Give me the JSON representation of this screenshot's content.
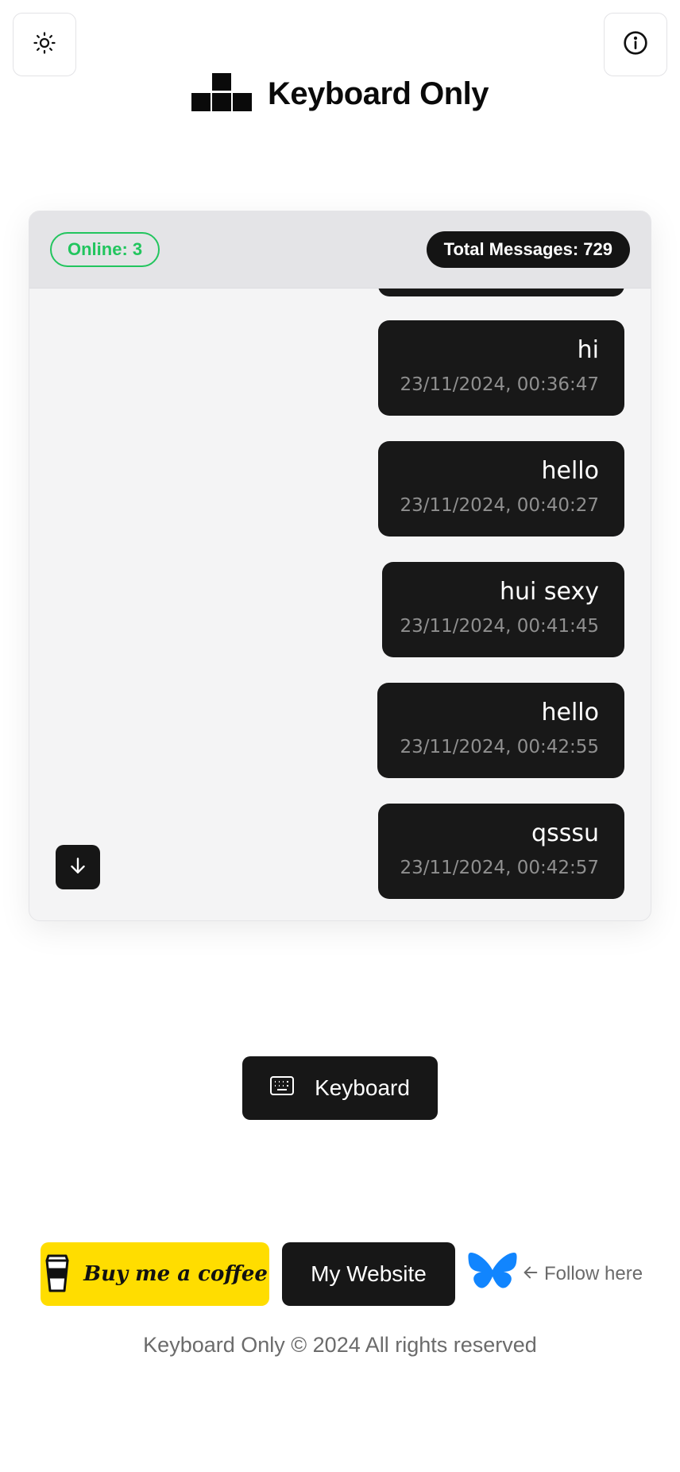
{
  "header": {
    "theme_icon": "sun-icon",
    "info_icon": "info-icon",
    "logo_icon": "keyboard-blocks-icon",
    "title": "Keyboard Only"
  },
  "chat": {
    "online_label": "Online: 3",
    "total_label": "Total Messages: 729",
    "messages": [
      {
        "text": "hi",
        "time": "23/11/2024, 00:36:47"
      },
      {
        "text": "hello",
        "time": "23/11/2024, 00:40:27"
      },
      {
        "text": "hui sexy",
        "time": "23/11/2024, 00:41:45"
      },
      {
        "text": "hello",
        "time": "23/11/2024, 00:42:55"
      },
      {
        "text": "qsssu",
        "time": "23/11/2024, 00:42:57"
      }
    ],
    "scroll_icon": "arrow-down-icon"
  },
  "keyboard_button": {
    "label": "Keyboard",
    "icon": "keyboard-icon"
  },
  "footer": {
    "coffee_label": "Buy me a coffee",
    "coffee_icon": "coffee-cup-icon",
    "website_label": "My Website",
    "follow_label": "Follow here",
    "follow_icon": "butterfly-icon",
    "arrow_icon": "arrow-left-icon",
    "copyright": "Keyboard Only © 2024 All rights reserved"
  },
  "colors": {
    "accent_online": "#22c55e",
    "dark": "#171717",
    "coffee_yellow": "#ffdd00",
    "butterfly_blue": "#1185fe"
  }
}
